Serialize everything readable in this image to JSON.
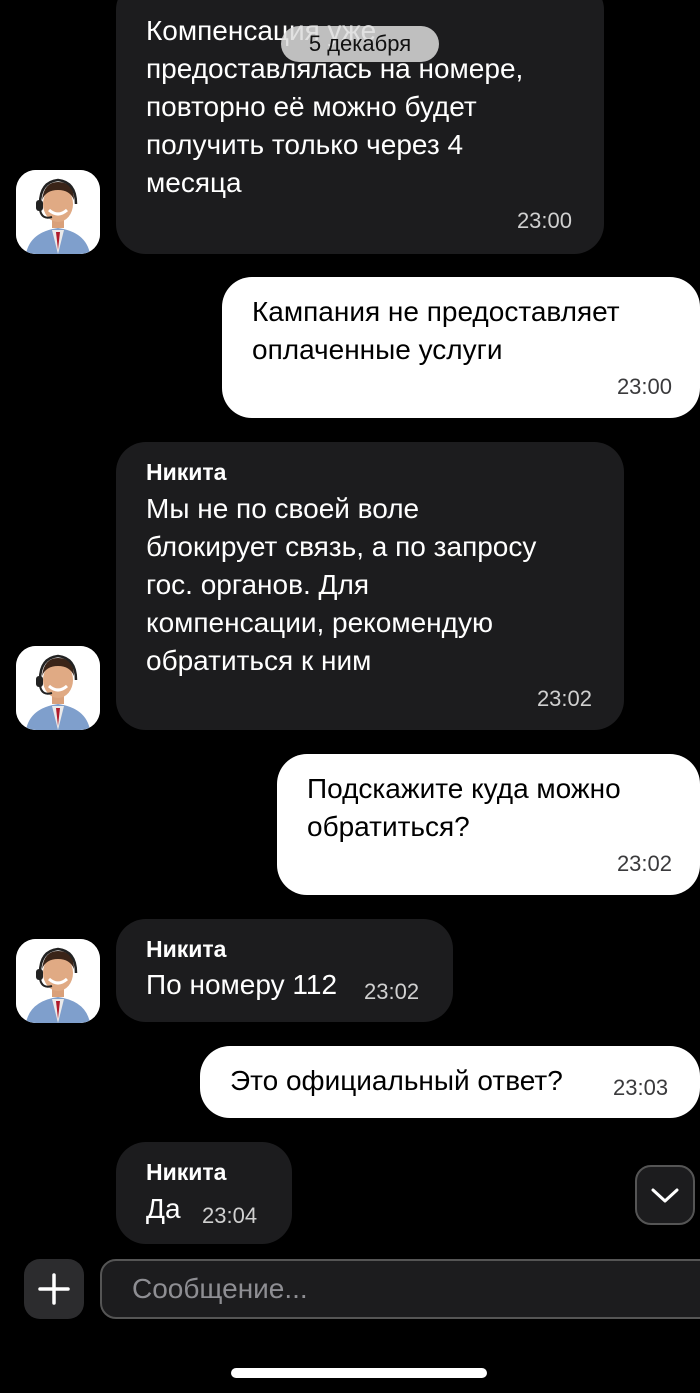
{
  "date_divider": "5 декабря",
  "messages": [
    {
      "direction": "in",
      "sender": "",
      "text": "Компенсация уже\nпредоставлялась на номере,\nповторно её можно будет\nполучить только через 4\nмесяца",
      "time": "23:00"
    },
    {
      "direction": "out",
      "text": "Кампания не предоставляет\nоплаченные услуги",
      "time": "23:00"
    },
    {
      "direction": "in",
      "sender": "Никита",
      "text": "Мы не по своей воле\nблокирует связь, а по запросу\nгос. органов. Для\nкомпенсации, рекомендую\nобратиться к ним",
      "time": "23:02"
    },
    {
      "direction": "out",
      "text": "Подскажите куда можно\nобратиться?",
      "time": "23:02"
    },
    {
      "direction": "in",
      "sender": "Никита",
      "text": "По номеру 112",
      "time": "23:02"
    },
    {
      "direction": "out",
      "text": "Это официальный ответ?",
      "time": "23:03"
    },
    {
      "direction": "in",
      "sender": "Никита",
      "text": "Да",
      "time": "23:04"
    }
  ],
  "composer": {
    "placeholder": "Сообщение..."
  },
  "icons": {
    "attach": "plus-icon",
    "scroll": "chevron-down-icon"
  },
  "colors": {
    "background": "#000000",
    "incoming_bubble": "#1c1c1e",
    "outgoing_bubble": "#ffffff"
  }
}
